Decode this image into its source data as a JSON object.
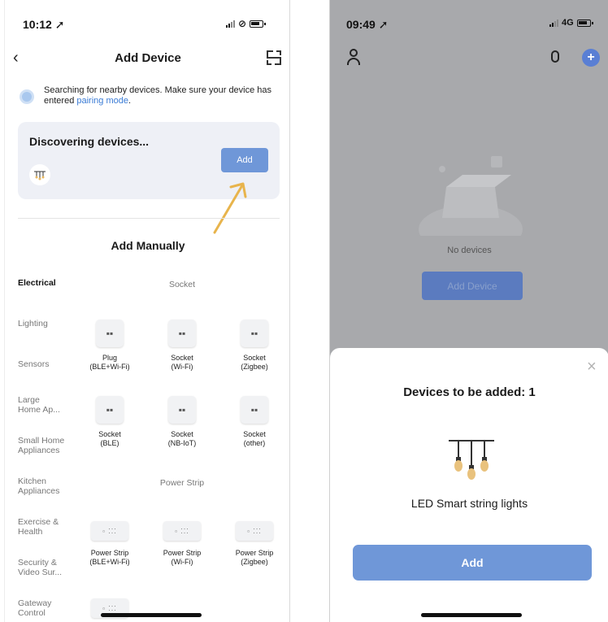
{
  "left": {
    "status": {
      "time": "10:12 ➚"
    },
    "nav": {
      "title": "Add Device",
      "back": "‹"
    },
    "search_note": {
      "text": "Searching for nearby devices. Make sure your device has entered ",
      "link": "pairing mode",
      "end": "."
    },
    "discover": {
      "title": "Discovering devices...",
      "add_label": "Add"
    },
    "manual_title": "Add Manually",
    "categories": [
      "Electrical",
      "Lighting",
      "Sensors",
      "Large Home Ap...",
      "Small Home Appliances",
      "Kitchen Appliances",
      "Exercise & Health",
      "Security & Video Sur...",
      "Gateway Control"
    ],
    "sections": {
      "socket": "Socket",
      "power_strip": "Power Strip"
    },
    "sockets": [
      {
        "name": "Plug",
        "sub": "(BLE+Wi-Fi)"
      },
      {
        "name": "Socket",
        "sub": "(Wi-Fi)"
      },
      {
        "name": "Socket",
        "sub": "(Zigbee)"
      },
      {
        "name": "Socket",
        "sub": "(BLE)"
      },
      {
        "name": "Socket",
        "sub": "(NB-IoT)"
      },
      {
        "name": "Socket",
        "sub": "(other)"
      }
    ],
    "strips": [
      {
        "name": "Power Strip",
        "sub": "(BLE+Wi-Fi)"
      },
      {
        "name": "Power Strip",
        "sub": "(Wi-Fi)"
      },
      {
        "name": "Power Strip",
        "sub": "(Zigbee)"
      }
    ]
  },
  "right": {
    "status": {
      "time": "09:49 ➚",
      "network": "4G"
    },
    "no_devices": "No devices",
    "add_device": "Add Device",
    "sheet": {
      "title": "Devices to be added: 1",
      "device": "LED Smart string lights",
      "add_label": "Add",
      "close": "×"
    }
  },
  "colors": {
    "accent": "#6f97d8",
    "dim_overlay": "#a8a9ac"
  }
}
